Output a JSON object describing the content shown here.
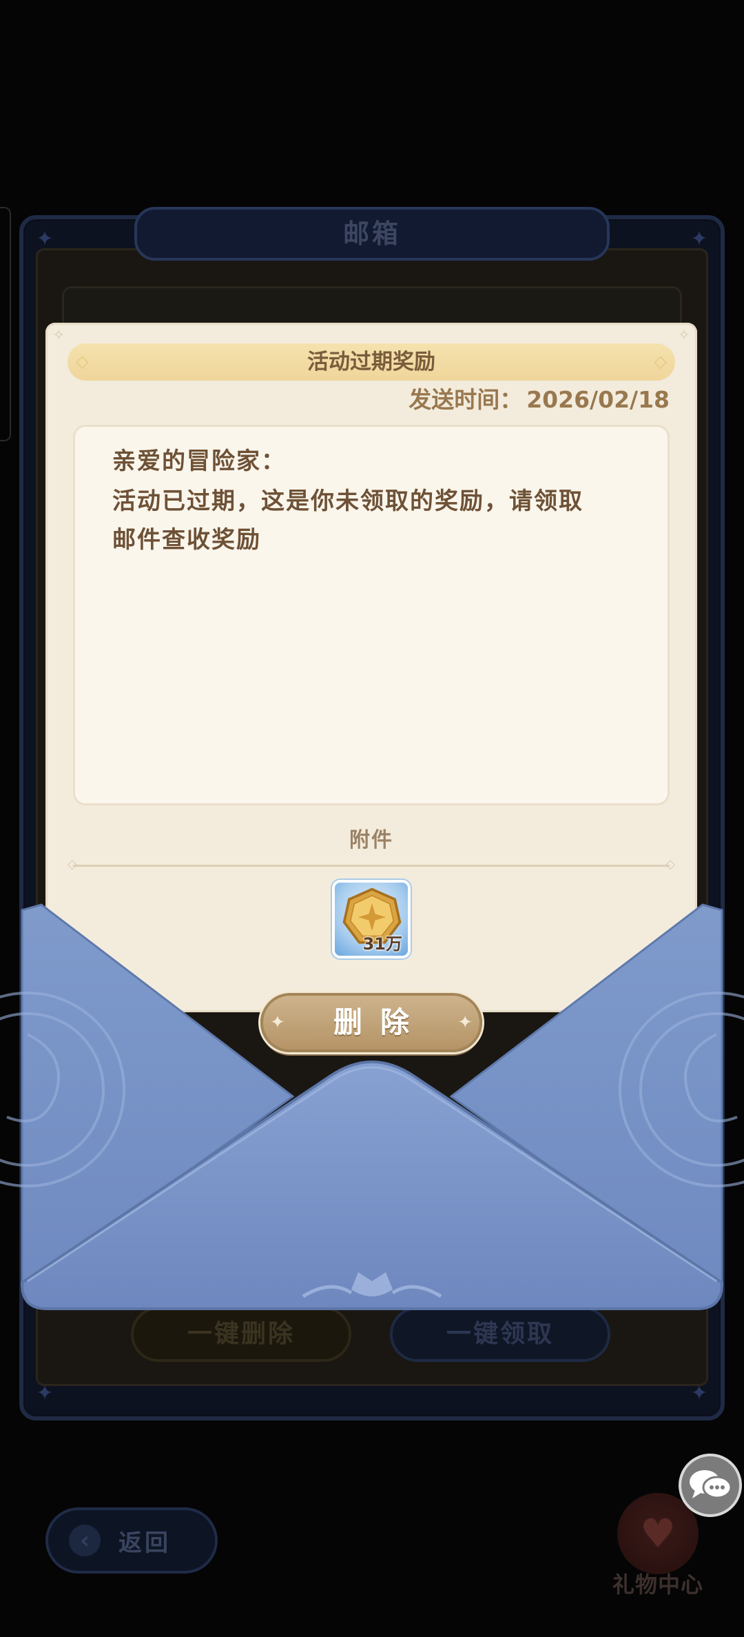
{
  "mailbox": {
    "title": "邮箱",
    "delete_all_label": "一键删除",
    "claim_all_label": "一键领取"
  },
  "mail": {
    "title": "活动过期奖励",
    "send_time_label": "发送时间：",
    "send_time_value": "2026/02/18",
    "greeting": "亲爱的冒险家：",
    "body_line1": "活动已过期，这是你未领取的奖励，请领取",
    "body_line2": "邮件查收奖励",
    "attachments_label": "附件",
    "attachments": [
      {
        "icon": "gold-coin-icon",
        "quantity": "31万"
      }
    ],
    "delete_label": "删除"
  },
  "nav": {
    "back_label": "返回",
    "gift_center_label": "礼物中心",
    "chat_icon": "chat-bubble-icon"
  },
  "colors": {
    "envelope_blue": "#7f9acb",
    "letter_paper": "#f3ecdd",
    "ribbon_gold": "#f2dca4",
    "text_brown": "#6e5136",
    "button_tan": "#c2a57b"
  }
}
